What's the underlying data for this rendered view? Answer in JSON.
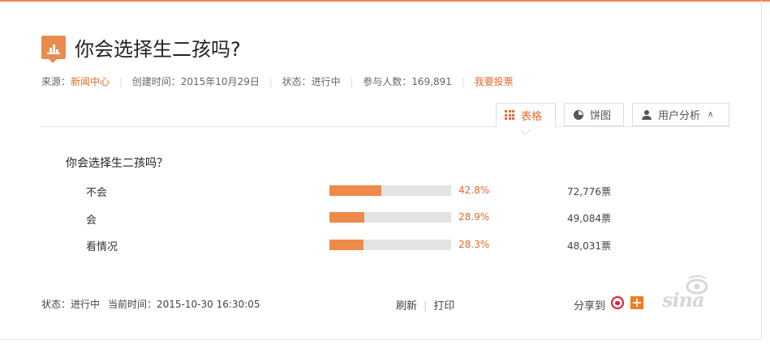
{
  "poll": {
    "title": "你会选择生二孩吗?",
    "meta": {
      "source_label": "来源：",
      "source_value": "新闻中心",
      "created_label": "创建时间：",
      "created_value": "2015年10月29日",
      "status_label": "状态：",
      "status_value": "进行中",
      "participants_label": "参与人数：",
      "participants_value": "169,891",
      "vote_link": "我要投票"
    }
  },
  "tabs": [
    {
      "label": "表格",
      "icon": "grid-icon",
      "active": true
    },
    {
      "label": "饼图",
      "icon": "pie-chart-icon",
      "active": false
    },
    {
      "label": "用户分析",
      "icon": "user-icon",
      "active": false
    }
  ],
  "results": {
    "question": "你会选择生二孩吗？",
    "options": [
      {
        "label": "不会",
        "percent_text": "42.8%",
        "percent": 42.8,
        "votes_text": "72,776票"
      },
      {
        "label": "会",
        "percent_text": "28.9%",
        "percent": 28.9,
        "votes_text": "49,084票"
      },
      {
        "label": "看情况",
        "percent_text": "28.3%",
        "percent": 28.3,
        "votes_text": "48,031票"
      }
    ]
  },
  "footer": {
    "status": "状态：进行中",
    "current_time": "当前时间：2015-10-30 16:30:05",
    "refresh": "刷新",
    "print": "打印",
    "share_label": "分享到"
  },
  "branding": {
    "logo_text": "sina"
  },
  "colors": {
    "accent": "#e66a2c",
    "bar_fill": "#ee8a4a",
    "bar_track": "#e3e3e3"
  }
}
